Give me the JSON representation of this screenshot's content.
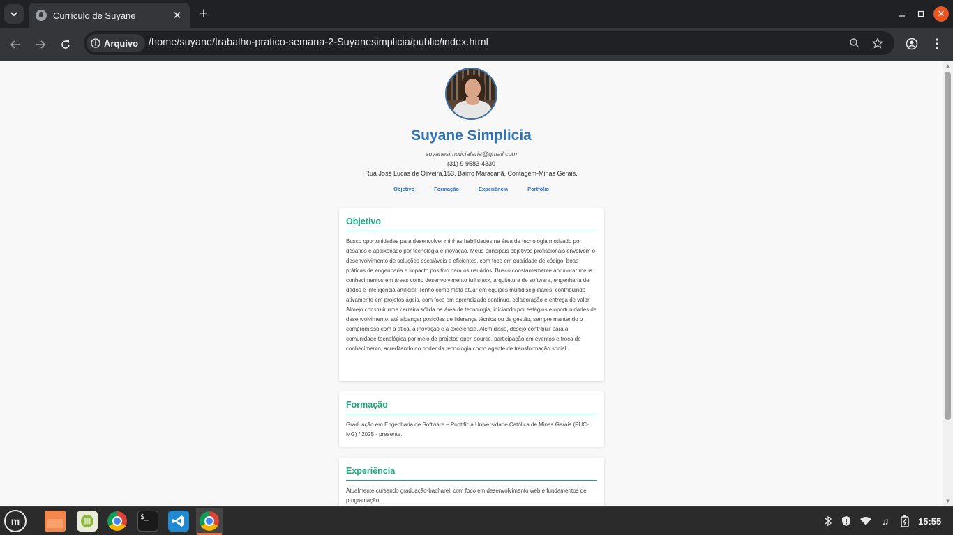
{
  "browser": {
    "tab_title": "Currículo de Suyane",
    "site_chip_label": "Arquivo",
    "url": "/home/suyane/trabalho-pratico-semana-2-Suyanesimplicia/public/index.html",
    "icons": [
      "tab-search-icon",
      "globe-favicon-icon",
      "close-icon",
      "plus-icon",
      "minimize-icon",
      "maximize-icon",
      "window-close-icon",
      "back-arrow-icon",
      "forward-arrow-icon",
      "reload-icon",
      "info-icon",
      "zoom-icon",
      "star-icon",
      "profile-icon",
      "kebab-menu-icon"
    ]
  },
  "resume": {
    "name": "Suyane Simplicia",
    "email": "suyanesimpliciafaria@gmail.com",
    "phone": "(31) 9 9583-4330",
    "address": "Rua José Lucas de Oliveira,153, Bairro Maracanã, Contagem-Minas Gerais.",
    "nav": [
      "Objetivo",
      "Formação",
      "Experiência",
      "Portfólio"
    ],
    "sections": [
      {
        "title": "Objetivo",
        "text": "Busco oportunidades para desenvolver minhas habilidades na área de tecnologia.motivado por desafios e apaixonado por tecnologia e inovação. Meus principais objetivos profissionais envolvem o desenvolvimento de soluções escaláveis e eficientes, com foco em qualidade de código, boas práticas de engenharia e impacto positivo para os usuários. Busco constantemente aprimorar meus conhecimentos em áreas como desenvolvimento full stack, arquitetura de software, engenharia de dados e inteligência artificial. Tenho como meta atuar em equipes multidisciplinares, contribuindo ativamente em projetos ágeis, com foco em aprendizado contínuo, colaboração e entrega de valor. Almejo construir uma carreira sólida na área de tecnologia, iniciando por estágios e oportunidades de desenvolvimento, até alcançar posições de liderança técnica ou de gestão, sempre mantendo o compromisso com a ética, a inovação e a excelência. Além disso, desejo contribuir para a comunidade tecnológica por meio de projetos open source, participação em eventos e troca de conhecimento, acreditando no poder da tecnologia como agente de transformação social."
      },
      {
        "title": "Formação",
        "text": "Graduação em Engenharia de Software – Pontifícia Universidade Católica de Minas Gerais (PUC-MG) / 2025 - presente."
      },
      {
        "title": "Experiência",
        "text": "Atualmente cursando graduação-bacharel, com foco em desenvolvimento web e fundamentos de programação."
      }
    ]
  },
  "taskbar": {
    "apps": [
      "mint-menu-icon",
      "files-icon",
      "calculator-icon",
      "chrome-icon",
      "terminal-icon",
      "vscode-icon",
      "chrome-active-icon"
    ],
    "terminal_glyph": "$_",
    "tray_icons": [
      "bluetooth-icon",
      "shield-icon",
      "wifi-icon",
      "music-icon",
      "battery-icon"
    ],
    "clock": "15:55"
  },
  "colors": {
    "accent_blue": "#2f72b8",
    "section_green": "#1aaa7f",
    "page_bg": "#f8f8f8",
    "chrome_dark": "#202124",
    "chrome_toolbar": "#35363a"
  }
}
